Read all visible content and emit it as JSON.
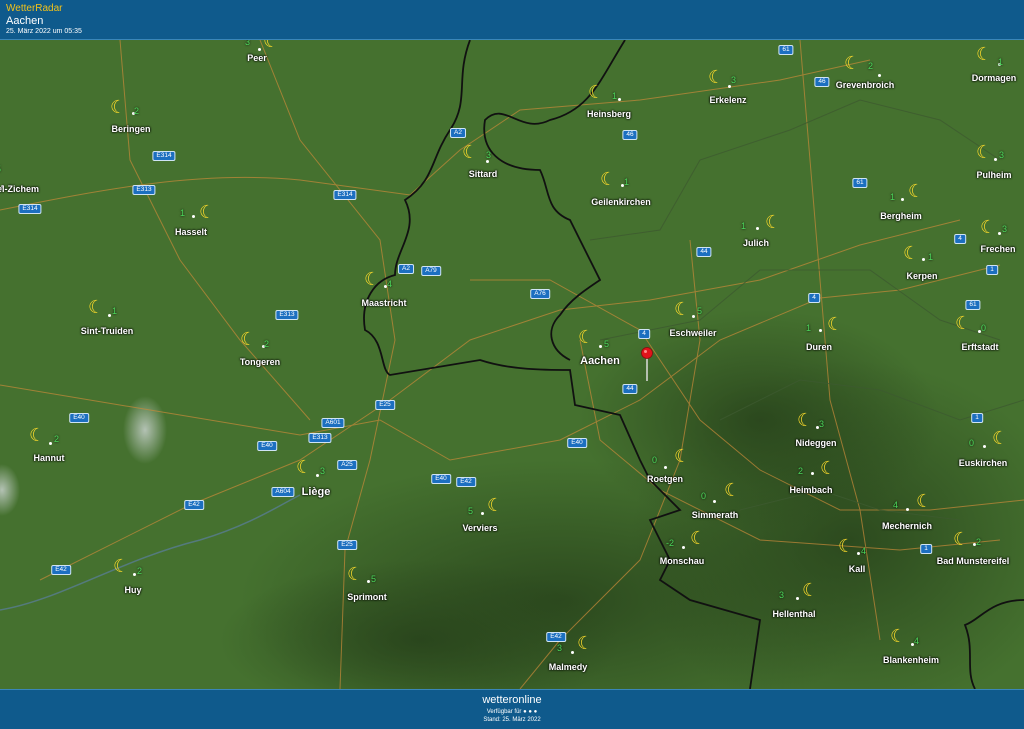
{
  "header": {
    "title": "WetterRadar",
    "location": "Aachen",
    "timestamp": "25. März 2022 um 05:35"
  },
  "footer": {
    "logo": "wetteronline",
    "availability": "Verfügbar für ● ● ●",
    "stand": "Stand: 25. März 2022"
  },
  "colors": {
    "header_bg": "#0f5a8c",
    "title": "#f2c21a",
    "temp": "#4bd65a",
    "moon": "#f7d82b",
    "road_badge": "#1c6fc0"
  },
  "weather_icon": "moon-icon",
  "cities": [
    {
      "name": "Peer",
      "temp": "3"
    },
    {
      "name": "Beringen",
      "temp": "2"
    },
    {
      "name": "Heinsberg",
      "temp": "1"
    },
    {
      "name": "Erkelenz",
      "temp": "3"
    },
    {
      "name": "Grevenbroich",
      "temp": "2"
    },
    {
      "name": "Dormagen",
      "temp": "1"
    },
    {
      "name": "Sittard",
      "temp": "3"
    },
    {
      "name": "Geilenkirchen",
      "temp": "1"
    },
    {
      "name": "Pulheim",
      "temp": "3"
    },
    {
      "name": "el-Zichem",
      "temp": "5"
    },
    {
      "name": "Hasselt",
      "temp": "1"
    },
    {
      "name": "Bergheim",
      "temp": "1"
    },
    {
      "name": "Julich",
      "temp": "1"
    },
    {
      "name": "Frechen",
      "temp": "3"
    },
    {
      "name": "Kerpen",
      "temp": "1"
    },
    {
      "name": "Maastricht",
      "temp": "4"
    },
    {
      "name": "Sint-Truiden",
      "temp": "1"
    },
    {
      "name": "Eschweiler",
      "temp": "5"
    },
    {
      "name": "Tongeren",
      "temp": "2"
    },
    {
      "name": "Duren",
      "temp": "1"
    },
    {
      "name": "Erftstadt",
      "temp": "0"
    },
    {
      "name": "Aachen",
      "temp": "5"
    },
    {
      "name": "Nideggen",
      "temp": "3"
    },
    {
      "name": "Hannut",
      "temp": "2"
    },
    {
      "name": "Euskirchen",
      "temp": "0"
    },
    {
      "name": "Liège",
      "temp": "3"
    },
    {
      "name": "Roetgen",
      "temp": "0"
    },
    {
      "name": "Heimbach",
      "temp": "2"
    },
    {
      "name": "Verviers",
      "temp": "5"
    },
    {
      "name": "Simmerath",
      "temp": "0"
    },
    {
      "name": "Mechernich",
      "temp": "4"
    },
    {
      "name": "Monschau",
      "temp": "-2"
    },
    {
      "name": "Kall",
      "temp": "4"
    },
    {
      "name": "Bad Munstereifel",
      "temp": "2"
    },
    {
      "name": "Huy",
      "temp": "2"
    },
    {
      "name": "Sprimont",
      "temp": "5"
    },
    {
      "name": "Hellenthal",
      "temp": "3"
    },
    {
      "name": "Blankenheim",
      "temp": "4"
    },
    {
      "name": "Malmedy",
      "temp": "3"
    }
  ],
  "roads": [
    "61",
    "46",
    "A2",
    "46",
    "E314",
    "E313",
    "E314",
    "61",
    "4",
    "E314",
    "44",
    "1",
    "A2",
    "A79",
    "A76",
    "4",
    "E313",
    "4",
    "61",
    "A601",
    "E25",
    "44",
    "E40",
    "1",
    "E40",
    "E313",
    "E40",
    "A25",
    "E40",
    "E42",
    "A604",
    "E42",
    "E25",
    "1",
    "E42",
    "E42"
  ]
}
